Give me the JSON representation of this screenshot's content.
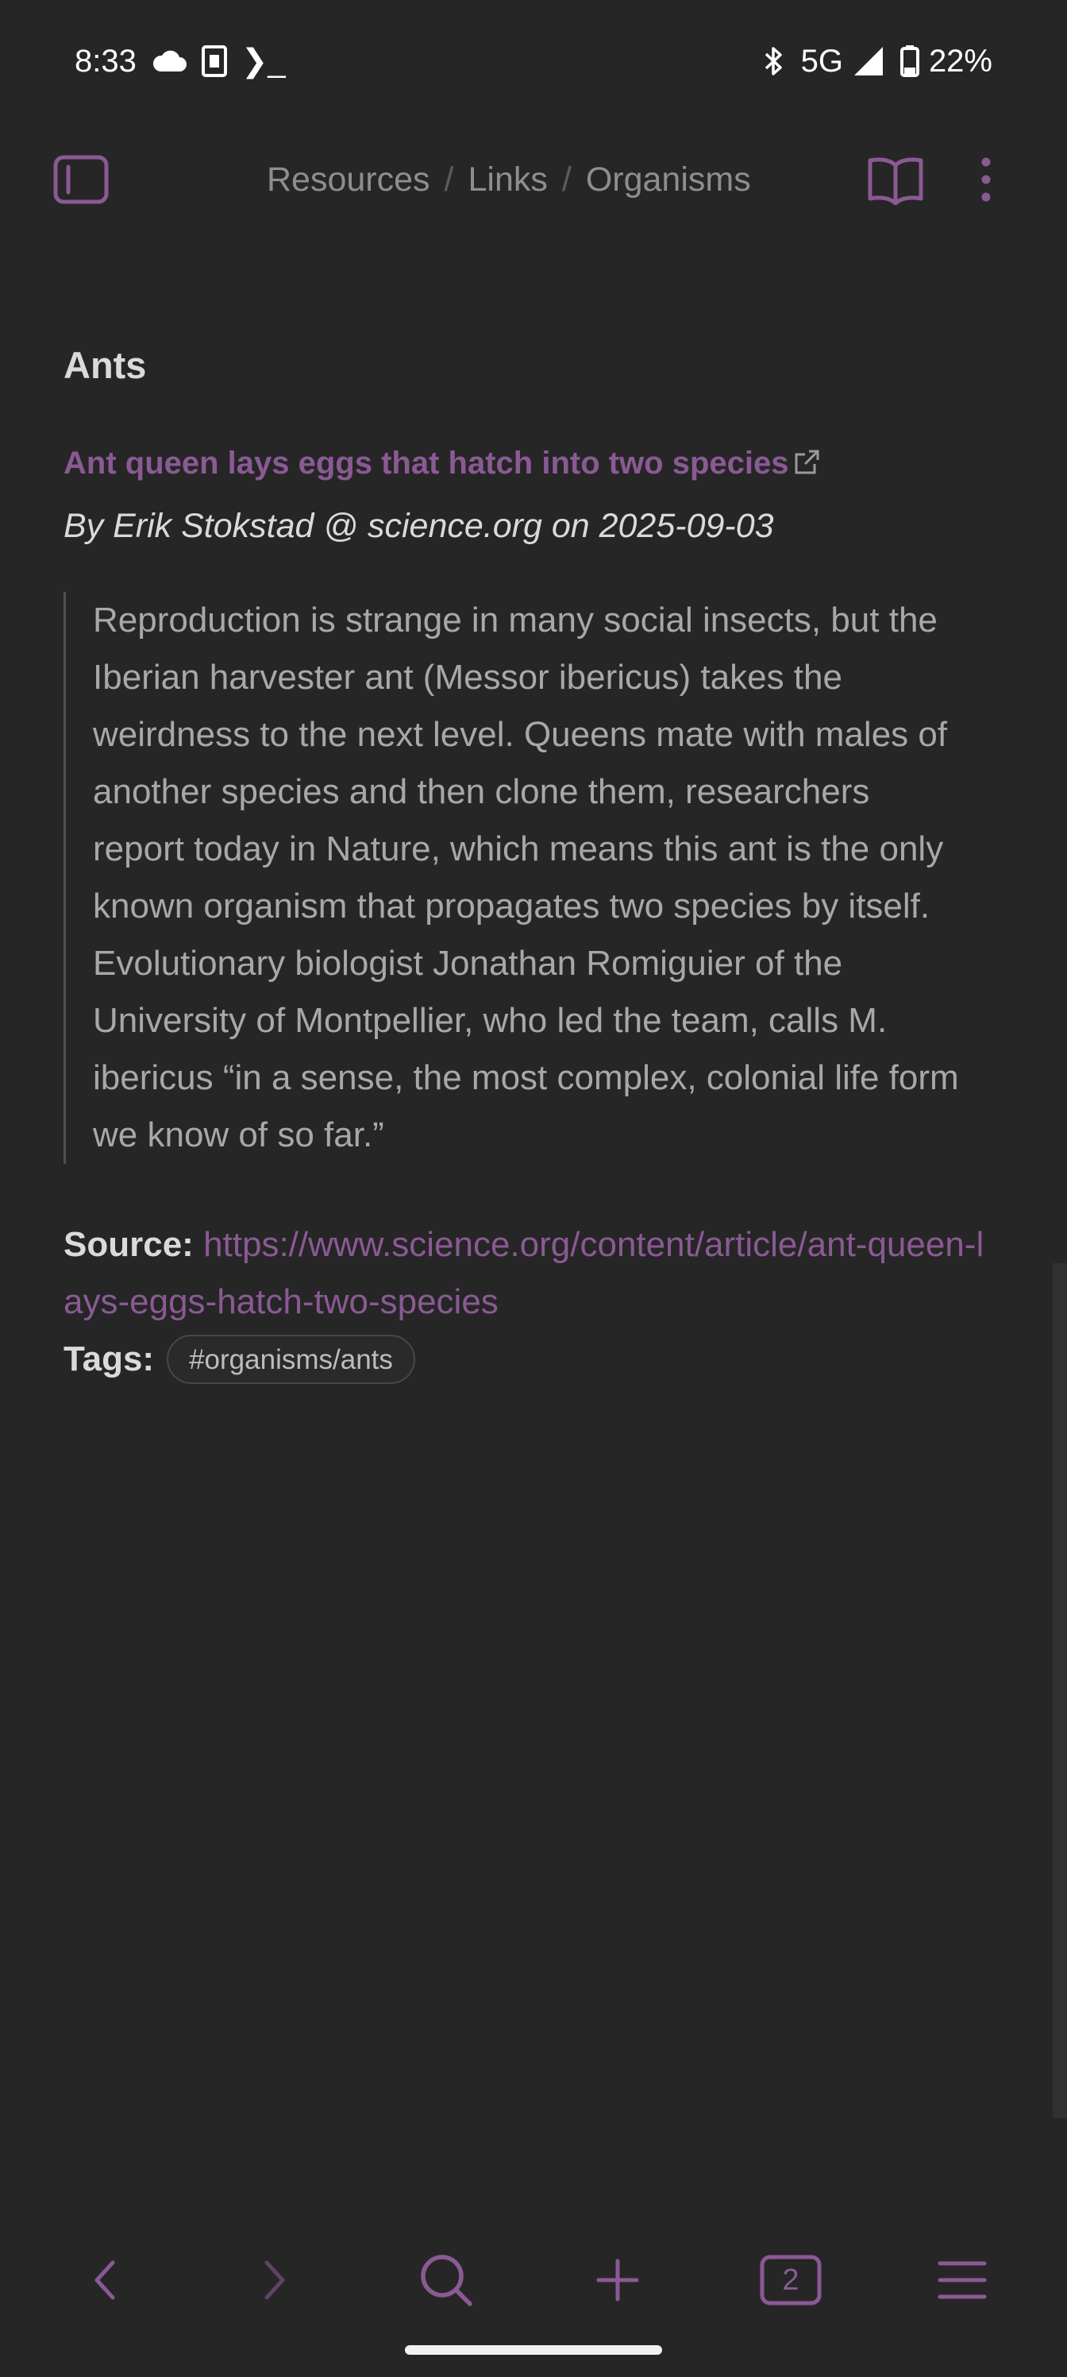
{
  "status_bar": {
    "time": "8:33",
    "left_icons": [
      "cloud-icon",
      "sim-card-icon",
      "terminal-icon"
    ],
    "terminal_glyph": "❯_",
    "network": "5G",
    "battery": "22%",
    "right_icons": [
      "bluetooth-icon",
      "signal-icon",
      "battery-icon"
    ]
  },
  "header": {
    "breadcrumbs": [
      "Resources",
      "Links",
      "Organisms"
    ],
    "separator": "/",
    "icons": [
      "sidebar-toggle-icon",
      "reading-mode-icon",
      "more-options-icon"
    ]
  },
  "note": {
    "heading": "Ants",
    "article_title": "Ant queen lays eggs that hatch into two species",
    "byline": "By Erik Stokstad @ science.org on 2025-09-03",
    "quote": "Reproduction is strange in many social insects, but the Iberian harvester ant (Messor ibericus) takes the weirdness to the next level. Queens mate with males of another species and then clone them, researchers report today in Nature, which means this ant is the only known organism that propagates two species by itself. Evolutionary biologist Jonathan Romiguier of the University of Montpellier, who led the team, calls M. ibericus “in a sense, the most complex, colonial life form we know of so far.”",
    "source_label": "Source:",
    "source_url": "https://www.science.org/content/article/ant-queen-lays-eggs-hatch-two-species",
    "tags_label": "Tags:",
    "tags": [
      "#organisms/ants"
    ]
  },
  "toolbar": {
    "tab_count": "2",
    "icons": [
      "back-icon",
      "forward-icon",
      "search-icon",
      "add-icon",
      "tabs-icon",
      "menu-icon"
    ]
  },
  "colors": {
    "background": "#262626",
    "accent": "#8a5a94",
    "text": "#dadada",
    "muted_text": "#a8a8a8"
  }
}
